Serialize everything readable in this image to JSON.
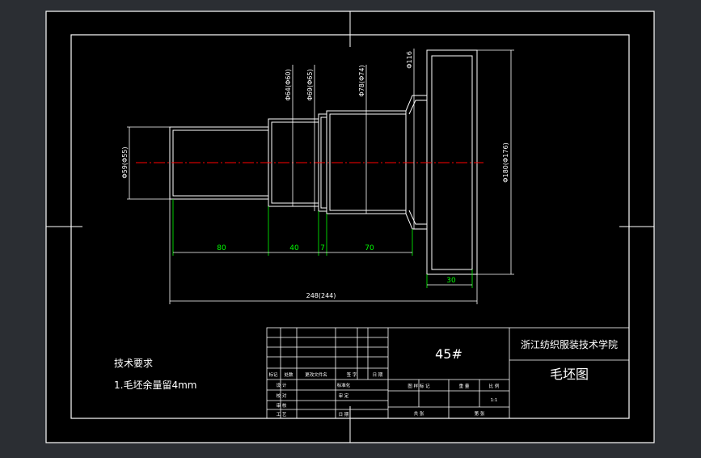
{
  "colors": {
    "background": "#2b2e33",
    "paper": "#000000",
    "line": "#ffffff",
    "centerline": "#ff0000",
    "dimension": "#00ff00"
  },
  "dimensions": {
    "seg1": "80",
    "seg2": "40",
    "seg3": "7",
    "seg4": "70",
    "flange_len": "30",
    "overall": "248(244)",
    "dia_left": "Φ59(Φ55)",
    "dia_mid1": "Φ64(Φ60)",
    "dia_mid2": "Φ69(Φ65)",
    "dia_mid3": "Φ78(Φ74)",
    "dia_flange": "Φ180(Φ176)",
    "dia_small": "Φ116"
  },
  "notes": {
    "title": "技术要求",
    "item1": "1.毛坯余量留4mm"
  },
  "title_block": {
    "material": "45#",
    "school": "浙江纺织服装技术学院",
    "drawing_name": "毛坯图",
    "row_labels": [
      "标记",
      "处数",
      "更改文件名",
      "签 字",
      "日 期"
    ],
    "left_rows": [
      "设 计",
      "校 对",
      "审 核",
      "工 艺"
    ],
    "standardization": "标准化",
    "approval": "审 定",
    "date_label": "日 期",
    "stage_label": "图 样 标 记",
    "weight_label": "重 量",
    "scale_label": "比 例",
    "scale_value": "1:1",
    "total_sheets": "共 张",
    "sheet_no": "第 张"
  }
}
